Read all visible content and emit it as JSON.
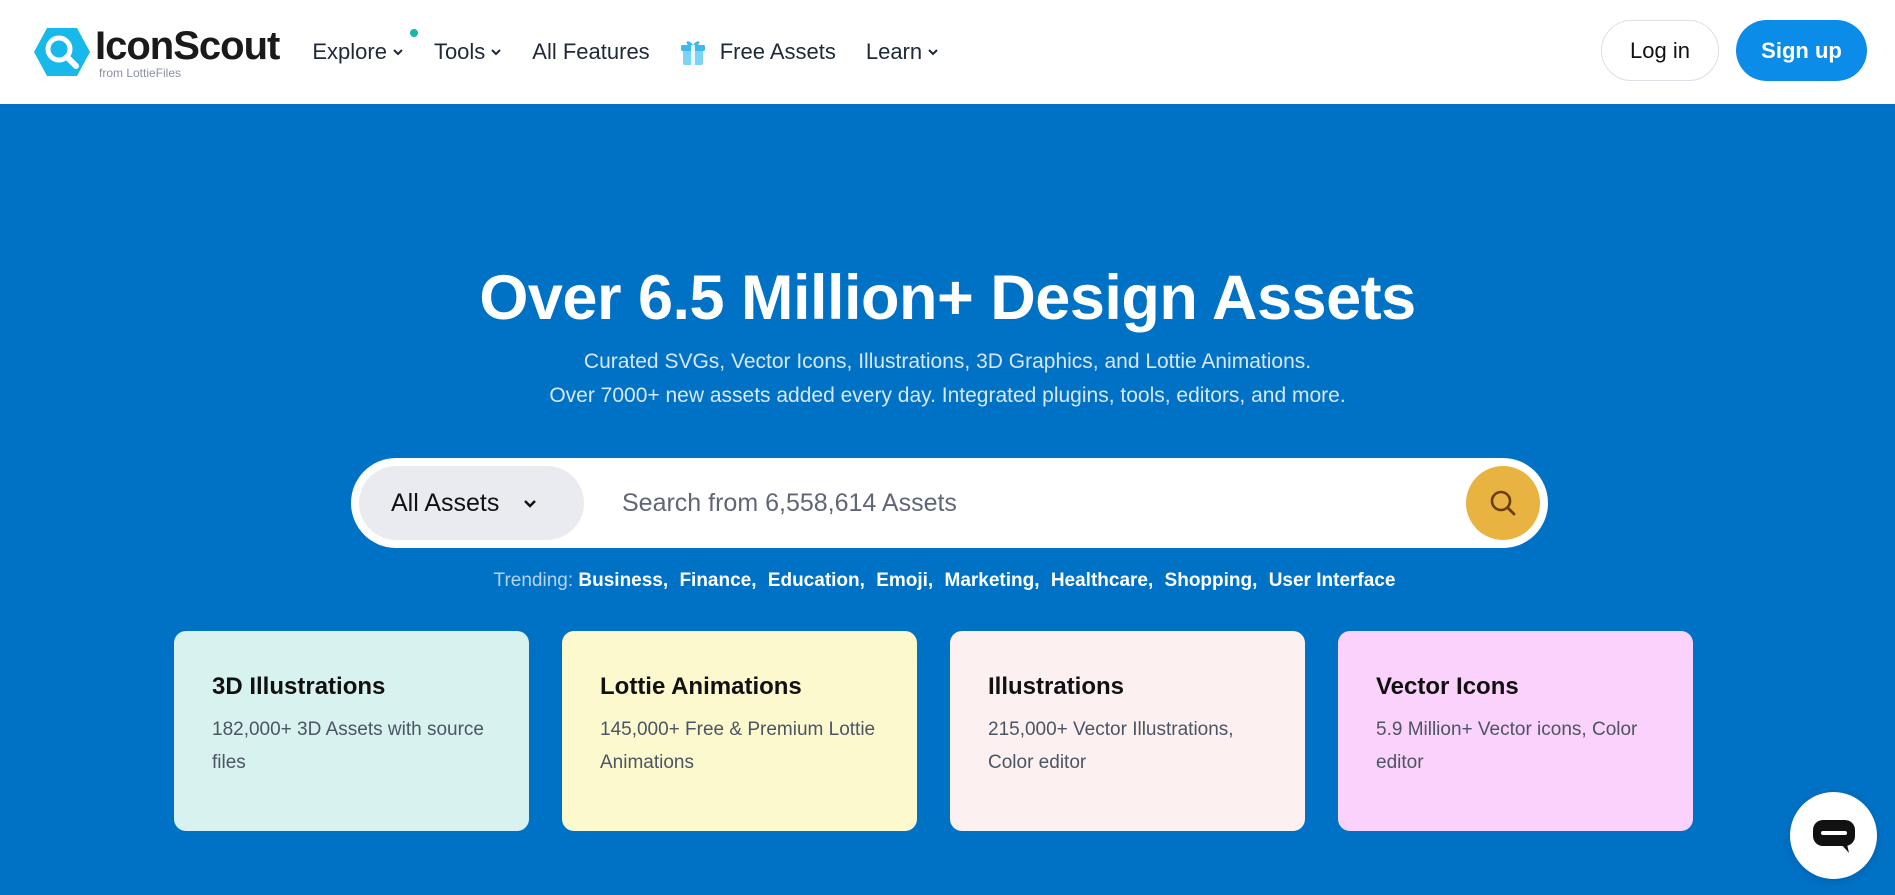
{
  "logo": {
    "name": "IconScout",
    "sub": "from LottieFiles"
  },
  "nav": {
    "explore": "Explore",
    "tools": "Tools",
    "all_features": "All Features",
    "free_assets": "Free Assets",
    "learn": "Learn"
  },
  "auth": {
    "login": "Log in",
    "signup": "Sign up"
  },
  "hero": {
    "title": "Over 6.5 Million+ Design Assets",
    "sub1": "Curated SVGs, Vector Icons, Illustrations, 3D Graphics, and Lottie Animations.",
    "sub2": "Over 7000+ new assets added every day. Integrated plugins, tools, editors, and more."
  },
  "search": {
    "type": "All Assets",
    "placeholder": "Search from 6,558,614 Assets"
  },
  "trending": {
    "label": "Trending:",
    "items": [
      "Business,",
      "Finance,",
      "Education,",
      "Emoji,",
      "Marketing,",
      "Healthcare,",
      "Shopping,",
      "User Interface"
    ]
  },
  "cards": [
    {
      "title": "3D Illustrations",
      "desc": "182,000+ 3D Assets with source files",
      "bg": "#d8f2ef"
    },
    {
      "title": "Lottie Animations",
      "desc": "145,000+ Free & Premium Lottie Animations",
      "bg": "#fdf9cf"
    },
    {
      "title": "Illustrations",
      "desc": "215,000+ Vector Illustrations, Color editor",
      "bg": "#fcf0f1"
    },
    {
      "title": "Vector Icons",
      "desc": "5.9 Million+ Vector icons, Color editor",
      "bg": "#fbd2fb"
    }
  ],
  "colors": {
    "hero_bg": "#0072c6",
    "signup_bg": "#0c8ce9",
    "search_btn": "#e8b340",
    "logo_accent": "#17b8ea"
  },
  "icons": {
    "logo": "search-magnifier-logo-icon",
    "gift": "gift-icon",
    "chevron": "chevron-down-icon",
    "search": "search-icon",
    "chat": "chat-bubble-icon"
  }
}
